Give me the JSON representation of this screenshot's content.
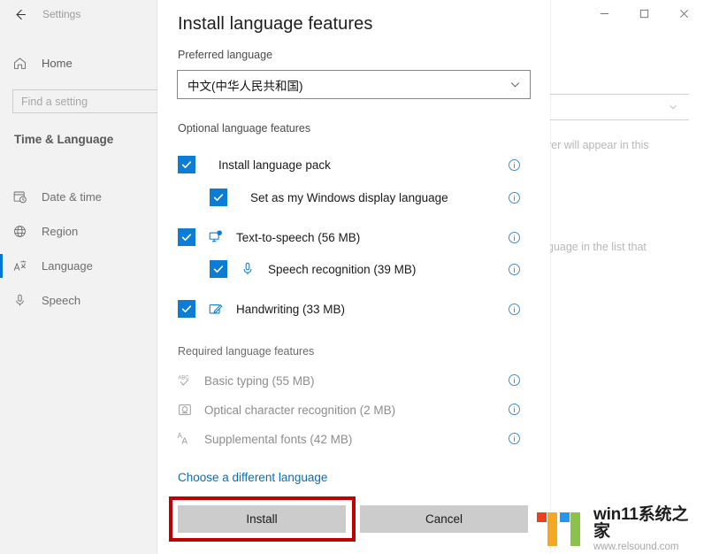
{
  "window": {
    "app_title": "Settings",
    "back_icon": "back-arrow-icon",
    "controls": [
      {
        "name": "minimize",
        "glyph": "─"
      },
      {
        "name": "maximize",
        "glyph": "□"
      },
      {
        "name": "close",
        "glyph": "✕"
      }
    ]
  },
  "sidebar": {
    "home_label": "Home",
    "home_icon": "home-icon",
    "search": {
      "placeholder": "Find a setting"
    },
    "category": "Time & Language",
    "items": [
      {
        "label": "Date & time",
        "icon": "calendar-clock-icon",
        "selected": false
      },
      {
        "label": "Region",
        "icon": "globe-icon",
        "selected": false
      },
      {
        "label": "Language",
        "icon": "language-icon",
        "selected": true
      },
      {
        "label": "Speech",
        "icon": "microphone-icon",
        "selected": false
      }
    ],
    "accent_color": "#0078d7"
  },
  "background_panel": {
    "text_line_1": "rer will appear in this",
    "text_line_2": "guage in the list that",
    "feature_icons": [
      "language-icon",
      "text-to-speech-icon",
      "microphone-icon",
      "handwriting-icon",
      "basic-typing-icon"
    ]
  },
  "dialog": {
    "title": "Install language features",
    "preferred_label": "Preferred language",
    "language_value": "中文(中华人民共和国)",
    "dropdown_icon": "chevron-down-icon",
    "optional_heading": "Optional language features",
    "optional_features": [
      {
        "label": "Install language pack",
        "checked": true,
        "indent": 0,
        "icon": null,
        "info": "info-icon"
      },
      {
        "label": "Set as my Windows display language",
        "checked": true,
        "indent": 1,
        "icon": null,
        "info": "info-icon"
      },
      {
        "label": "Text-to-speech (56 MB)",
        "checked": true,
        "indent": 0,
        "icon": "text-to-speech-icon",
        "info": "info-icon"
      },
      {
        "label": "Speech recognition (39 MB)",
        "checked": true,
        "indent": 1,
        "icon": "microphone-icon",
        "info": "info-icon"
      },
      {
        "label": "Handwriting (33 MB)",
        "checked": true,
        "indent": 0,
        "icon": "handwriting-icon",
        "info": "info-icon"
      }
    ],
    "required_heading": "Required language features",
    "required_features": [
      {
        "label": "Basic typing (55 MB)",
        "icon": "abc-check-icon",
        "info": "info-icon"
      },
      {
        "label": "Optical character recognition (2 MB)",
        "icon": "ocr-icon",
        "info": "info-icon"
      },
      {
        "label": "Supplemental fonts (42 MB)",
        "icon": "fonts-icon",
        "info": "info-icon"
      }
    ],
    "choose_link": "Choose a different language",
    "install_label": "Install",
    "cancel_label": "Cancel",
    "highlight_color": "#c00000",
    "checkbox_color": "#0c7cd5",
    "link_color": "#0b6cb5"
  },
  "watermark": {
    "title": "win11系统之家",
    "url": "www.relsound.com",
    "logo_colors": [
      "#e8411f",
      "#f5a623",
      "#2196f3",
      "#8bc34a"
    ]
  }
}
